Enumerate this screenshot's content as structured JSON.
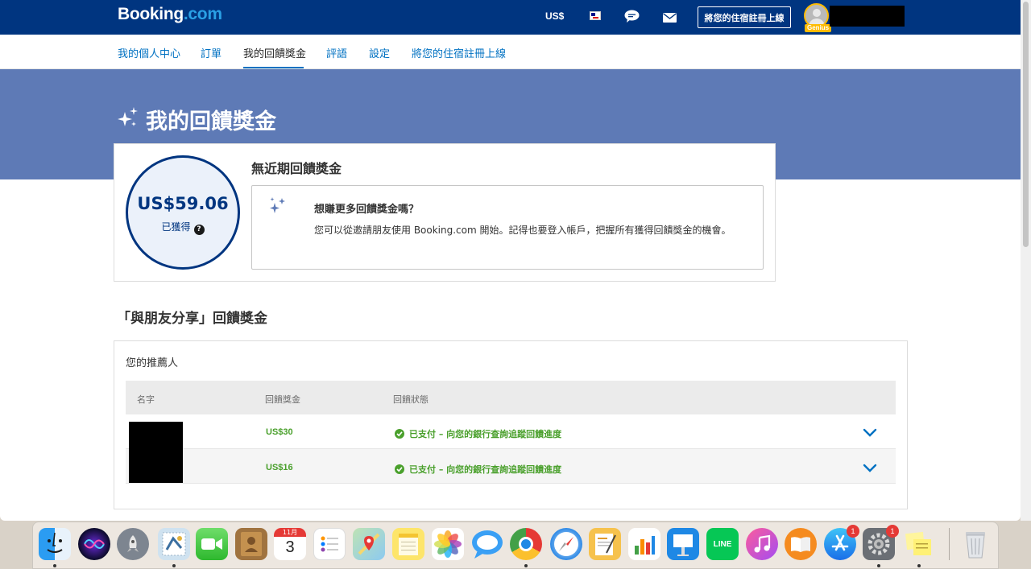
{
  "header": {
    "logo_main": "Booking",
    "logo_dot": ".com",
    "currency": "US$",
    "list_property_label": "將您的住宿註冊上線",
    "genius_label": "Genius"
  },
  "nav": {
    "items": [
      {
        "label": "我的個人中心"
      },
      {
        "label": "訂單"
      },
      {
        "label": "我的回饋獎金"
      },
      {
        "label": "評語"
      },
      {
        "label": "設定"
      },
      {
        "label": "將您的住宿註冊上線"
      }
    ],
    "active_index": 2
  },
  "hero": {
    "title": "我的回饋獎金"
  },
  "summary": {
    "balance": "US$59.06",
    "earned_label": "已獲得",
    "help_glyph": "?",
    "recent_heading": "無近期回饋獎金",
    "promo_title": "想賺更多回饋獎金嗎？",
    "promo_text": "您可以從邀請朋友使用 Booking.com 開始。記得也要登入帳戶，把握所有獲得回饋獎金的機會。"
  },
  "referral": {
    "section_title": "「與朋友分享」回饋獎金",
    "heading": "您的推薦人",
    "columns": [
      "名字",
      "回饋獎金",
      "回饋狀態"
    ],
    "rows": [
      {
        "amount": "US$30",
        "status": "已支付 – 向您的銀行查詢追蹤回饋進度"
      },
      {
        "amount": "US$16",
        "status": "已支付 – 向您的銀行查詢追蹤回饋進度"
      }
    ]
  },
  "dock": {
    "calendar_month": "11月",
    "calendar_day": "3",
    "line_label": "LINE",
    "appstore_badge": "1",
    "settings_badge": "1"
  },
  "colors": {
    "brand_navy": "#003580",
    "link_blue": "#0071c2",
    "hero_blue": "#5e7ab6",
    "success_green": "#4aa02c"
  }
}
